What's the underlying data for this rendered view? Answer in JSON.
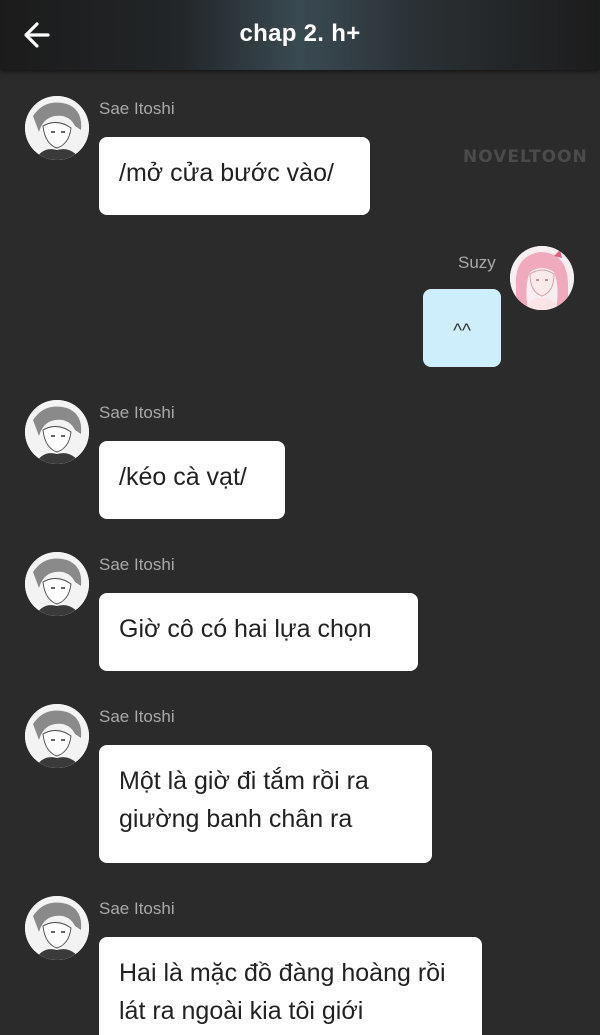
{
  "header": {
    "title": "chap 2. h+",
    "back_icon": "arrow-left-icon"
  },
  "watermark": "NOVELTOON",
  "messages": [
    {
      "sender": "Sae Itoshi",
      "side": "left",
      "text": "/mở cửa bước vào/"
    },
    {
      "sender": "Suzy",
      "side": "right",
      "text": "^^"
    },
    {
      "sender": "Sae Itoshi",
      "side": "left",
      "text": "/kéo cà vạt/"
    },
    {
      "sender": "Sae Itoshi",
      "side": "left",
      "text": "Giờ cô có hai lựa chọn"
    },
    {
      "sender": "Sae Itoshi",
      "side": "left",
      "text": "Một là giờ đi tắm rồi ra giường banh chân ra"
    },
    {
      "sender": "Sae Itoshi",
      "side": "left",
      "text": "Hai là mặc đồ đàng hoàng rồi lát ra ngoài kia tôi giới"
    }
  ],
  "colors": {
    "background": "#2b2b2b",
    "bubble_other": "#ffffff",
    "bubble_me": "#cfeefb",
    "sender_name": "#a9a9a9"
  }
}
